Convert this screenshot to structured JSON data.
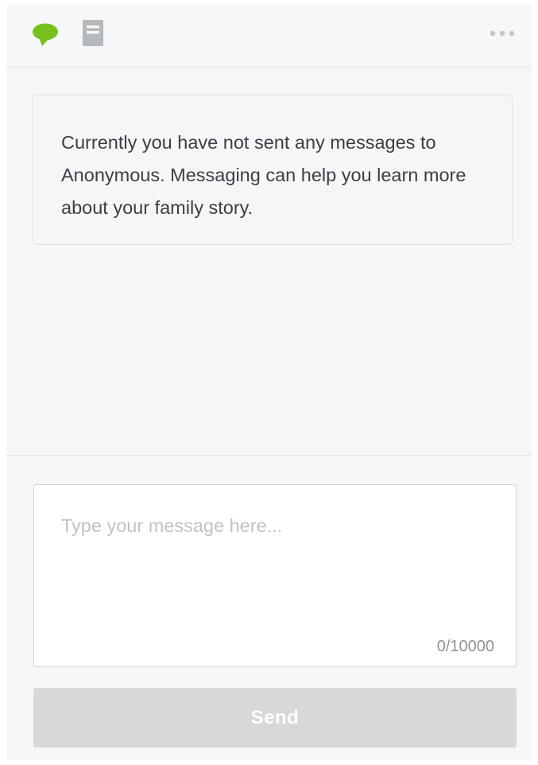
{
  "toolbar": {
    "chat_icon": "speech-bubble-icon",
    "document_icon": "document-icon",
    "more_icon": "more-options-icon"
  },
  "notice": {
    "text": "Currently you have not sent any messages to Anonymous. Messaging can help you learn more about your family story."
  },
  "compose": {
    "placeholder": "Type your message here...",
    "value": "",
    "counter": "0/10000"
  },
  "send": {
    "label": "Send"
  },
  "colors": {
    "accent_green": "#78c020",
    "icon_gray": "#b6b9bc",
    "send_disabled_bg": "#d7d8d9"
  }
}
